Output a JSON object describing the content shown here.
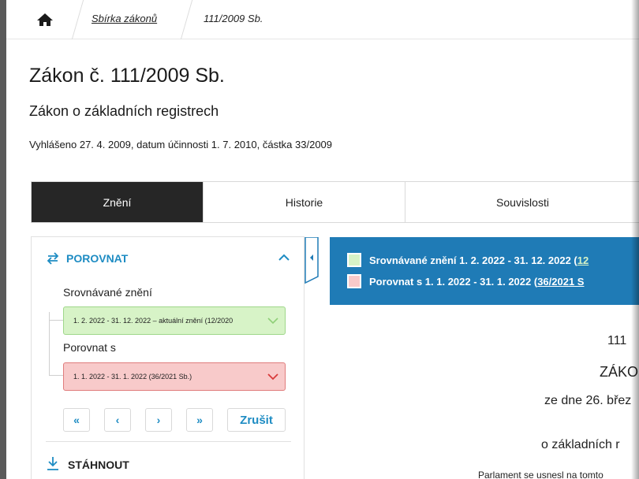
{
  "breadcrumb": {
    "home_icon": "home-icon",
    "link": "Sbírka zákonů",
    "current": "111/2009 Sb."
  },
  "header": {
    "title": "Zákon č. 111/2009 Sb.",
    "subtitle": "Zákon o základních registrech",
    "published": "Vyhlášeno 27. 4. 2009, datum účinnosti 1. 7. 2010, částka 33/2009"
  },
  "tabs": [
    {
      "label": "Znění",
      "active": true
    },
    {
      "label": "Historie",
      "active": false
    },
    {
      "label": "Souvislosti",
      "active": false
    }
  ],
  "compare": {
    "heading": "POROVNAT",
    "compared_label": "Srovnávané znění",
    "compared_value": "1. 2. 2022 - 31. 12. 2022 – aktuální znění (12/2020",
    "with_label": "Porovnat s",
    "with_value": "1. 1. 2022 - 31. 1. 2022 (36/2021 Sb.)",
    "nav": [
      "«",
      "‹",
      "›",
      "»"
    ],
    "cancel": "Zrušit",
    "download": "STÁHNOUT"
  },
  "legend": {
    "row1_text": "Srovnávané znění 1. 2. 2022 - 31. 12. 2022 (",
    "row1_link": "12",
    "row2_text": "Porovnat s 1. 1. 2022 - 31. 1. 2022 (",
    "row2_link": "36/2021 S"
  },
  "document": {
    "number": "111",
    "heading": "ZÁKO",
    "date": "ze dne 26. břez",
    "subject": "o základních r",
    "intro": "Parlament se usnesl na tomto"
  },
  "colors": {
    "accent": "#1e8cc3",
    "legend_bg": "#1f7bb6",
    "green": "#d7f3c7",
    "red": "#f8caca",
    "tab_active": "#262626"
  }
}
